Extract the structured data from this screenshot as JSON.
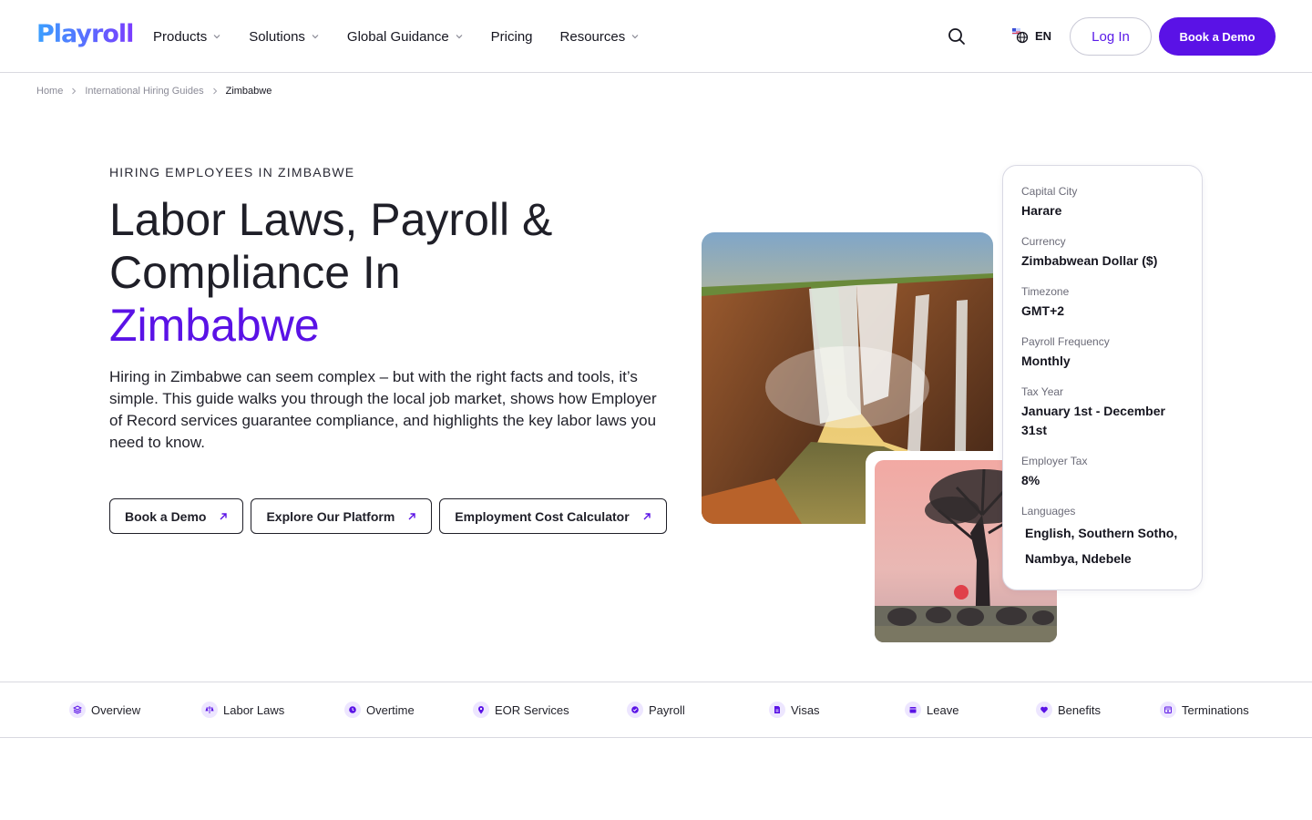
{
  "header": {
    "logo_text": "Playroll",
    "nav": [
      {
        "label": "Products",
        "has_dropdown": true
      },
      {
        "label": "Solutions",
        "has_dropdown": true
      },
      {
        "label": "Global Guidance",
        "has_dropdown": true
      },
      {
        "label": "Pricing",
        "has_dropdown": false
      },
      {
        "label": "Resources",
        "has_dropdown": true
      }
    ],
    "search_icon": "search-icon",
    "language_label": "EN",
    "language_icon": "globe-flag-icon",
    "login_label": "Log In",
    "demo_label": "Book a Demo"
  },
  "breadcrumb": {
    "items": [
      "Home",
      "International Hiring Guides",
      "Zimbabwe"
    ]
  },
  "hero": {
    "eyebrow": "HIRING EMPLOYEES IN ZIMBABWE",
    "headline_line1": "Labor Laws, Payroll &",
    "headline_line2": "Compliance In",
    "headline_accent": "Zimbabwe",
    "intro": "Hiring in Zimbabwe can seem complex – but with the right facts and tools, it’s simple. This guide walks you through the local job market, shows how Employer of Record services guarantee compliance, and highlights the key labor laws you need to know.",
    "ctas": [
      "Book a Demo",
      "Explore Our Platform",
      "Employment Cost Calculator"
    ]
  },
  "info_card": {
    "items": [
      {
        "label": "Capital City",
        "value": "Harare"
      },
      {
        "label": "Currency",
        "value": "Zimbabwean Dollar ($)"
      },
      {
        "label": "Timezone",
        "value": "GMT+2"
      },
      {
        "label": "Payroll Frequency",
        "value": "Monthly"
      },
      {
        "label": "Tax Year",
        "value": "January 1st - December 31st"
      },
      {
        "label": "Employer Tax",
        "value": "8%"
      },
      {
        "label": "Languages",
        "value": "English, Southern Sotho, Nambya, Ndebele"
      }
    ]
  },
  "tabs": [
    {
      "label": "Overview",
      "icon": "layers-icon"
    },
    {
      "label": "Labor Laws",
      "icon": "scales-icon"
    },
    {
      "label": "Overtime",
      "icon": "clock-icon"
    },
    {
      "label": "EOR Services",
      "icon": "location-icon"
    },
    {
      "label": "Payroll",
      "icon": "check-badge-icon"
    },
    {
      "label": "Visas",
      "icon": "document-icon"
    },
    {
      "label": "Leave",
      "icon": "calendar-icon"
    },
    {
      "label": "Benefits",
      "icon": "heart-icon"
    },
    {
      "label": "Terminations",
      "icon": "calendar-x-icon"
    }
  ],
  "colors": {
    "brand_purple": "#5a12e6",
    "text_dark": "#1f1f28",
    "muted": "#6b6b78",
    "border": "#d9d9e0"
  }
}
